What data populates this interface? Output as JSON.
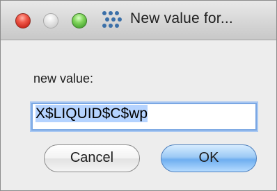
{
  "window": {
    "title": "New value for..."
  },
  "dialog": {
    "prompt_label": "new value:",
    "value": "X$LIQUID$C$wp"
  },
  "buttons": {
    "cancel_label": "Cancel",
    "ok_label": "OK"
  },
  "colors": {
    "close": "#e0443a",
    "zoom": "#5cb646",
    "default_button": "#6eaef0",
    "focus_ring": "#7aa7e3"
  }
}
